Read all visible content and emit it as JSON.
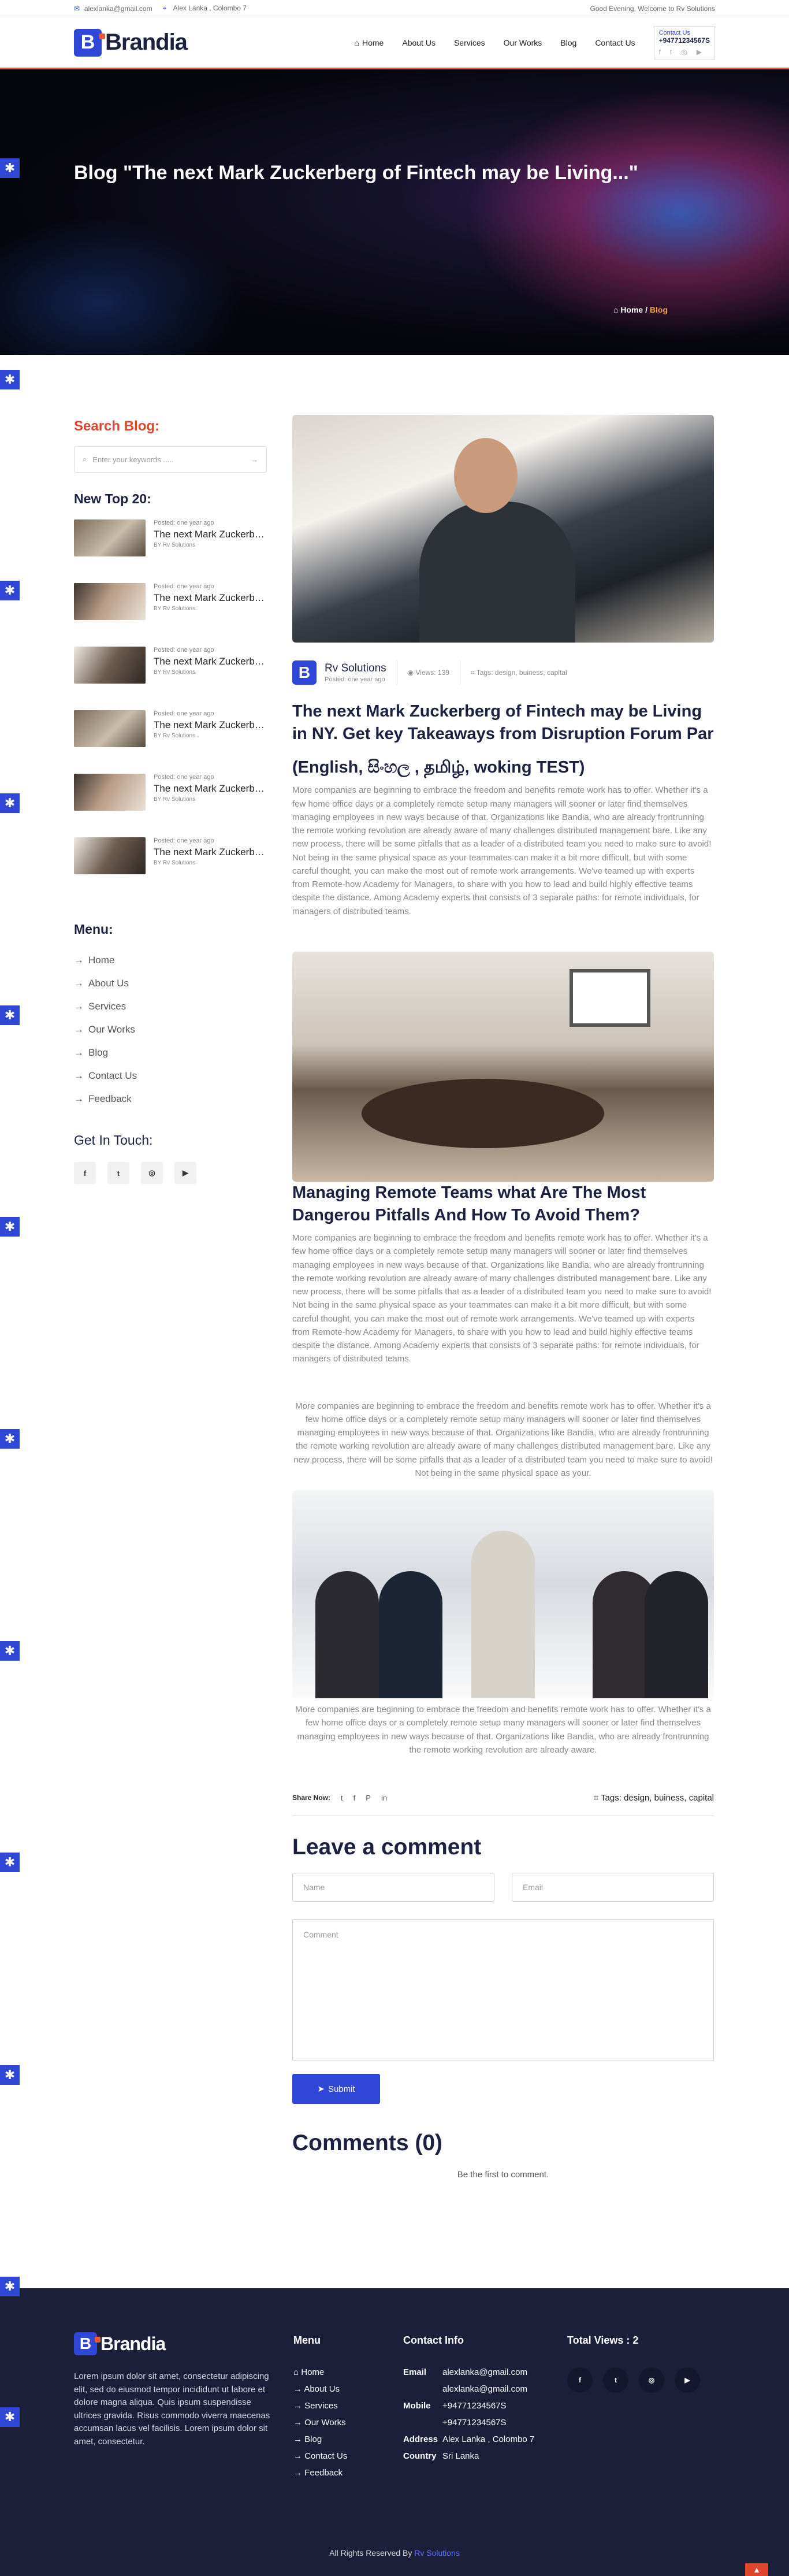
{
  "topbar": {
    "email": "alexlanka@gmail.com",
    "address": "Alex Lanka , Colombo 7",
    "greeting": "Good Evening, Welcome to Rv Solutions"
  },
  "header": {
    "brand": "Brandia",
    "nav": [
      "Home",
      "About Us",
      "Services",
      "Our Works",
      "Blog",
      "Contact Us"
    ],
    "contact_label": "Contact Us",
    "phone": "+94771234567S"
  },
  "hero": {
    "title": "Blog \"The next Mark Zuckerberg of Fintech may be Living...\"",
    "crumb_home": "Home",
    "crumb_current": "Blog"
  },
  "sidebar": {
    "search_title": "Search Blog:",
    "search_placeholder": "Enter your keywords .....",
    "top_title": "New Top 20:",
    "posts": [
      {
        "meta": "Posted: one year ago",
        "title": "The next Mark Zuckerberg of Fintech may be Living",
        "by": "BY Rv Solutions"
      },
      {
        "meta": "Posted: one year ago",
        "title": "The next Mark Zuckerberg of Fintech may be Living",
        "by": "BY Rv Solutions"
      },
      {
        "meta": "Posted: one year ago",
        "title": "The next Mark Zuckerberg of Fintech may be Living",
        "by": "BY Rv Solutions"
      },
      {
        "meta": "Posted: one year ago",
        "title": "The next Mark Zuckerberg of Fintech may be Living",
        "by": "BY Rv Solutions"
      },
      {
        "meta": "Posted: one year ago",
        "title": "The next Mark Zuckerberg of Fintech may be Living",
        "by": "BY Rv Solutions"
      },
      {
        "meta": "Posted: one year ago",
        "title": "The next Mark Zuckerberg of Fintech may be Living",
        "by": "BY Rv Solutions"
      }
    ],
    "menu_title": "Menu:",
    "menu": [
      "Home",
      "About Us",
      "Services",
      "Our Works",
      "Blog",
      "Contact Us",
      "Feedback"
    ],
    "touch_title": "Get In Touch:"
  },
  "article": {
    "author": "Rv Solutions",
    "posted": "Posted: one year ago",
    "views": "Views: 139",
    "tags": "Tags: design, buiness, capital",
    "title": "The next Mark Zuckerberg of Fintech may be Living in NY. Get key Takeaways from Disruption Forum Par",
    "subtitle": "(English, සිංහල , தமிழ், woking TEST)",
    "para1": "More companies are beginning to embrace the freedom and benefits remote work has to offer. Whether it's a few home office days or a completely remote setup many managers will sooner or later find themselves managing employees in new ways because of that. Organizations like Bandia, who are already frontrunning the remote working revolution are already aware of many challenges distributed management bare. Like any new process, there will be some pitfalls that as a leader of a distributed team you need to make sure to avoid! Not being in the same physical space as your teammates can make it a bit more difficult, but with some careful thought, you can make the most out of remote work arrangements. We've teamed up with experts from Remote-how Academy for Managers, to share with you how to lead and build highly effective teams despite the distance. Among Academy experts that consists of 3 separate paths: for remote individuals, for managers of distributed teams.",
    "h2": "Managing Remote Teams what Are The Most Dangerou Pitfalls And How To Avoid Them?",
    "para2": "More companies are beginning to embrace the freedom and benefits remote work has to offer. Whether it's a few home office days or a completely remote setup many managers will sooner or later find themselves managing employees in new ways because of that. Organizations like Bandia, who are already frontrunning the remote working revolution are already aware of many challenges distributed management bare. Like any new process, there will be some pitfalls that as a leader of a distributed team you need to make sure to avoid! Not being in the same physical space as your teammates can make it a bit more difficult, but with some careful thought, you can make the most out of remote work arrangements. We've teamed up with experts from Remote-how Academy for Managers, to share with you how to lead and build highly effective teams despite the distance. Among Academy experts that consists of 3 separate paths: for remote individuals, for managers of distributed teams.",
    "para3": "More companies are beginning to embrace the freedom and benefits remote work has to offer. Whether it's a few home office days or a completely remote setup many managers will sooner or later find themselves managing employees in new ways because of that. Organizations like Bandia, who are already frontrunning the remote working revolution are already aware of many challenges distributed management bare. Like any new process, there will be some pitfalls that as a leader of a distributed team you need to make sure to avoid! Not being in the same physical space as your.",
    "para4": "More companies are beginning to embrace the freedom and benefits remote work has to offer. Whether it's a few home office days or a completely remote setup many managers will sooner or later find themselves managing employees in new ways because of that. Organizations like Bandia, who are already frontrunning the remote working revolution are already aware.",
    "share_label": "Share Now:",
    "tags_bottom": "Tags: design, buiness, capital"
  },
  "comment_form": {
    "title": "Leave a comment",
    "name_placeholder": "Name",
    "email_placeholder": "Email",
    "comment_placeholder": "Comment",
    "submit": "Submit"
  },
  "comments": {
    "title": "Comments (0)",
    "empty": "Be the first to comment."
  },
  "footer": {
    "brand": "Brandia",
    "about": "Lorem ipsum dolor sit amet, consectetur adipiscing elit, sed do eiusmod tempor incididunt ut labore et dolore magna aliqua. Quis ipsum suspendisse ultrices gravida. Risus commodo viverra maecenas accumsan lacus vel facilisis. Lorem ipsum dolor sit amet, consectetur.",
    "menu_title": "Menu",
    "menu": [
      "Home",
      "About Us",
      "Services",
      "Our Works",
      "Blog",
      "Contact Us",
      "Feedback"
    ],
    "contact_title": "Contact Info",
    "email_label": "Email",
    "email1": "alexlanka@gmail.com",
    "email2": "alexlanka@gmail.com",
    "mobile_label": "Mobile",
    "mobile1": "+94771234567S",
    "mobile2": "+94771234567S",
    "address_label": "Address",
    "address": "Alex Lanka , Colombo 7",
    "country_label": "Country",
    "country": "Sri Lanka",
    "views_title": "Total Views : 2",
    "copyright": "All Rights Reserved By",
    "copyright_link": "Rv Solutions"
  }
}
